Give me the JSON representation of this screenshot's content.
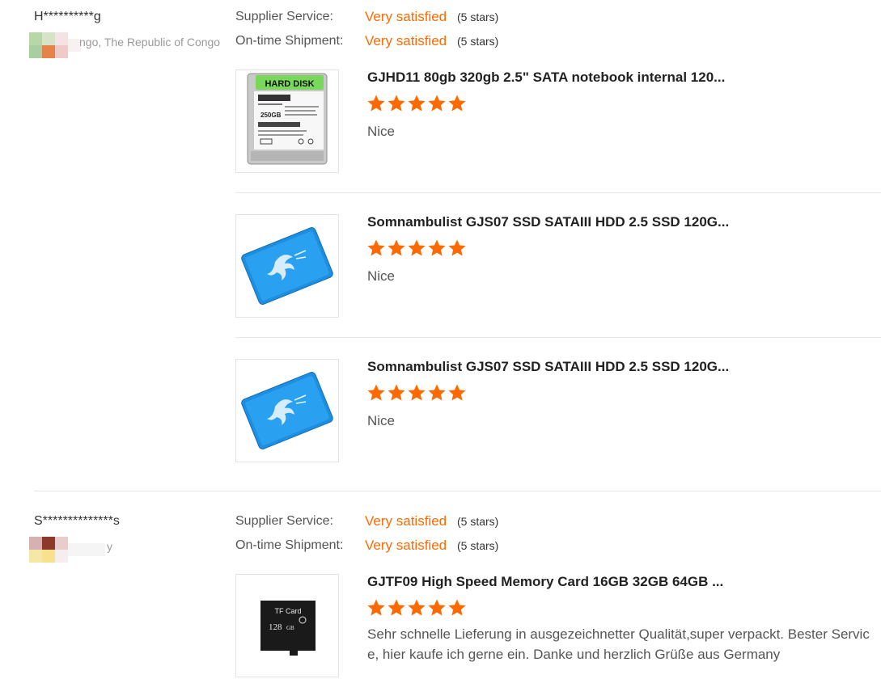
{
  "colors": {
    "accent": "#ff6a00",
    "star": "#ff6a00"
  },
  "reviews": [
    {
      "buyer": {
        "name": "H**********g",
        "country": "ngo, The Republic of Congo"
      },
      "ratings": [
        {
          "label": "Supplier Service:",
          "value": "Very satisfied",
          "stars_text": "(5 stars)"
        },
        {
          "label": "On-time Shipment:",
          "value": "Very satisfied",
          "stars_text": "(5 stars)"
        }
      ],
      "products": [
        {
          "title": "GJHD11 80gb 320gb 2.5\" SATA notebook internal 120...",
          "rating": 5,
          "comment": "Nice",
          "image": "hard-disk-image"
        },
        {
          "title": "Somnambulist GJS07 SSD SATAIII HDD 2.5 SSD 120G...",
          "rating": 5,
          "comment": "Nice",
          "image": "blue-ssd-image"
        },
        {
          "title": "Somnambulist GJS07 SSD SATAIII HDD 2.5 SSD 120G...",
          "rating": 5,
          "comment": "Nice",
          "image": "blue-ssd-image"
        }
      ]
    },
    {
      "buyer": {
        "name": "S**************s",
        "country": "y"
      },
      "ratings": [
        {
          "label": "Supplier Service:",
          "value": "Very satisfied",
          "stars_text": "(5 stars)"
        },
        {
          "label": "On-time Shipment:",
          "value": "Very satisfied",
          "stars_text": "(5 stars)"
        }
      ],
      "products": [
        {
          "title": "GJTF09 High Speed Memory Card 16GB 32GB 64GB ...",
          "rating": 5,
          "comment": "Sehr schnelle Lieferung in ausgezeichnetter Qualität,super verpackt. Bester Servic e, hier kaufe ich gerne ein. Danke und herzlich Grüße aus Germany",
          "image": "tf-card-image"
        }
      ]
    }
  ],
  "images": {
    "hard_disk_label": "HARD DISK",
    "hard_disk_capacity": "250GB",
    "tf_card_label": "TF Card",
    "tf_card_capacity": "128",
    "tf_card_unit": "GB"
  }
}
